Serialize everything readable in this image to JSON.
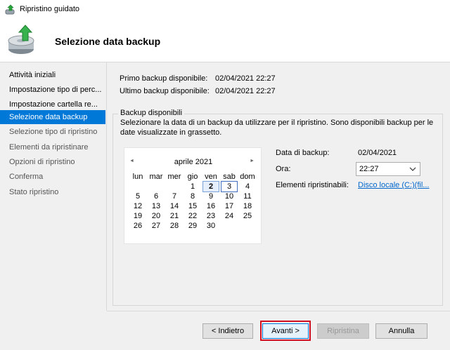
{
  "window": {
    "title": "Ripristino guidato"
  },
  "header": {
    "title": "Selezione data backup"
  },
  "nav": {
    "items": [
      {
        "label": "Attività iniziali",
        "state": "done"
      },
      {
        "label": "Impostazione tipo di perc...",
        "state": "done"
      },
      {
        "label": "Impostazione cartella re...",
        "state": "done"
      },
      {
        "label": "Selezione data backup",
        "state": "active"
      },
      {
        "label": "Selezione tipo di ripristino",
        "state": "pending"
      },
      {
        "label": "Elementi da ripristinare",
        "state": "pending"
      },
      {
        "label": "Opzioni di ripristino",
        "state": "pending"
      },
      {
        "label": "Conferma",
        "state": "pending"
      },
      {
        "label": "Stato ripristino",
        "state": "pending"
      }
    ]
  },
  "info": {
    "first_label": "Primo backup disponibile:",
    "first_value": "02/04/2021 22:27",
    "last_label": "Ultimo backup disponibile:",
    "last_value": "02/04/2021 22:27"
  },
  "group": {
    "legend": "Backup disponibili",
    "description": "Selezionare la data di un backup da utilizzare per il ripristino. Sono disponibili backup per le date visualizzate in grassetto."
  },
  "calendar": {
    "month": "aprile 2021",
    "prev_symbol": "◄",
    "next_symbol": "►",
    "weekdays": [
      "lun",
      "mar",
      "mer",
      "gio",
      "ven",
      "sab",
      "dom"
    ],
    "weeks": [
      [
        "",
        "",
        "",
        "1",
        "2",
        "3",
        "4"
      ],
      [
        "5",
        "6",
        "7",
        "8",
        "9",
        "10",
        "11"
      ],
      [
        "12",
        "13",
        "14",
        "15",
        "16",
        "17",
        "18"
      ],
      [
        "19",
        "20",
        "21",
        "22",
        "23",
        "24",
        "25"
      ],
      [
        "26",
        "27",
        "28",
        "29",
        "30",
        "",
        ""
      ]
    ],
    "selected_day": "2",
    "today_day": "3",
    "bold_days": [
      "2"
    ]
  },
  "details": {
    "date_label": "Data di backup:",
    "date_value": "02/04/2021",
    "time_label": "Ora:",
    "time_value": "22:27",
    "items_label": "Elementi ripristinabili:",
    "items_link": "Disco locale (C:)(fil..."
  },
  "buttons": {
    "back": "< Indietro",
    "next": "Avanti >",
    "restore": "Ripristina",
    "cancel": "Annulla"
  },
  "colors": {
    "accent": "#0078d7",
    "link": "#0066cc",
    "highlight": "#d01020"
  },
  "icons": {
    "app": "backup-restore-icon",
    "header": "disk-restore-icon",
    "dropdown": "chevron-down-icon"
  }
}
